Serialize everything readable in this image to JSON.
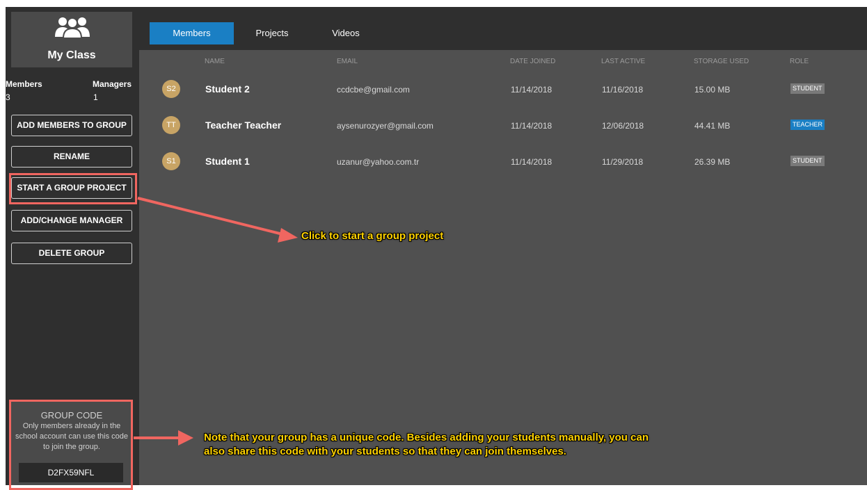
{
  "group": {
    "name": "My Class",
    "stats": {
      "members_label": "Members",
      "members_count": "3",
      "managers_label": "Managers",
      "managers_count": "1"
    },
    "buttons": {
      "add_members": "ADD MEMBERS TO GROUP",
      "rename": "RENAME",
      "start_project": "START A GROUP PROJECT",
      "add_manager": "ADD/CHANGE MANAGER",
      "delete": "DELETE GROUP"
    },
    "code": {
      "title": "GROUP CODE",
      "description": "Only members already in the school account can use this code to join the group.",
      "value": "D2FX59NFL"
    }
  },
  "tabs": [
    "Members",
    "Projects",
    "Videos"
  ],
  "active_tab": "Members",
  "table": {
    "headers": [
      "NAME",
      "EMAIL",
      "DATE JOINED",
      "LAST ACTIVE",
      "STORAGE USED",
      "ROLE"
    ],
    "rows": [
      {
        "initials": "S2",
        "name": "Student 2",
        "email": "ccdcbe@gmail.com",
        "joined": "11/14/2018",
        "last_active": "11/16/2018",
        "storage": "15.00 MB",
        "role": "STUDENT"
      },
      {
        "initials": "TT",
        "name": "Teacher Teacher",
        "email": "aysenurozyer@gmail.com",
        "joined": "11/14/2018",
        "last_active": "12/06/2018",
        "storage": "44.41 MB",
        "role": "TEACHER"
      },
      {
        "initials": "S1",
        "name": "Student 1",
        "email": "uzanur@yahoo.com.tr",
        "joined": "11/14/2018",
        "last_active": "11/29/2018",
        "storage": "26.39 MB",
        "role": "STUDENT"
      }
    ]
  },
  "annotations": {
    "start_project": "Click to start a group project",
    "group_code_line1": "Note that your group has a unique code. Besides adding your students manually, you can",
    "group_code_line2": "also share this code with your students so that they can join themselves."
  },
  "colors": {
    "accent": "#1a7fc4",
    "highlight": "#f06660",
    "annotation_text": "#ffd200",
    "avatar": "#c8a465"
  }
}
